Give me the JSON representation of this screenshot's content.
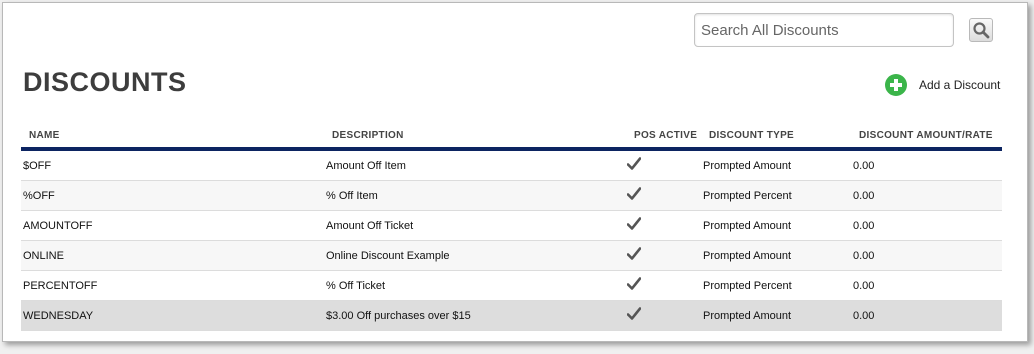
{
  "search": {
    "placeholder": "Search All Discounts",
    "value": ""
  },
  "page_title": "DISCOUNTS",
  "add_button": {
    "label": "Add a Discount",
    "icon": "plus-circle-icon",
    "color": "#3bb54a"
  },
  "table": {
    "header_rule_color": "#0c2461",
    "headers": {
      "name": "NAME",
      "description": "DESCRIPTION",
      "pos_active": "POS ACTIVE",
      "discount_type": "DISCOUNT TYPE",
      "amount_rate": "DISCOUNT AMOUNT/RATE"
    },
    "rows": [
      {
        "name": "$OFF",
        "description": "Amount Off Item",
        "pos_active": true,
        "type": "Prompted Amount",
        "amount": "0.00"
      },
      {
        "name": "%OFF",
        "description": "% Off Item",
        "pos_active": true,
        "type": "Prompted Percent",
        "amount": "0.00"
      },
      {
        "name": "AMOUNTOFF",
        "description": "Amount Off Ticket",
        "pos_active": true,
        "type": "Prompted Amount",
        "amount": "0.00"
      },
      {
        "name": "ONLINE",
        "description": "Online Discount Example",
        "pos_active": true,
        "type": "Prompted Amount",
        "amount": "0.00"
      },
      {
        "name": "PERCENTOFF",
        "description": "% Off Ticket",
        "pos_active": true,
        "type": "Prompted Percent",
        "amount": "0.00"
      },
      {
        "name": "WEDNESDAY",
        "description": "$3.00 Off purchases over $15",
        "pos_active": true,
        "type": "Prompted Amount",
        "amount": "0.00"
      }
    ],
    "selected_row": 5
  }
}
